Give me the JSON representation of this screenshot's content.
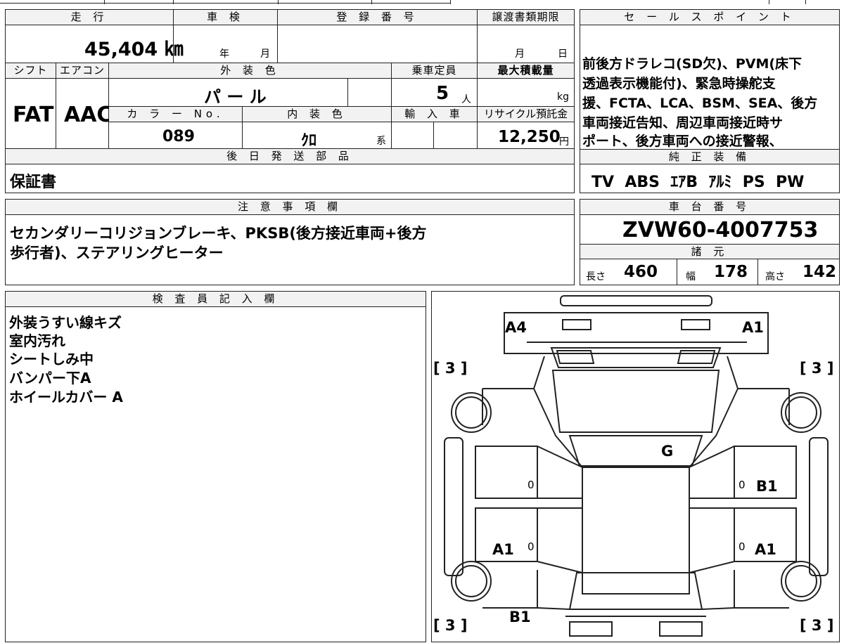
{
  "top": {
    "mileage_label": "走 行",
    "inspection_label": "車 検",
    "registration_label": "登 録 番 号",
    "transfer_label": "譲渡書類期限",
    "sales_label": "セ ー ル ス ポ イ ン ト",
    "mileage_value": "45,404 ㎞",
    "year_unit": "年",
    "month_unit": "月",
    "transfer_month": "月",
    "transfer_day": "日"
  },
  "row2": {
    "shift_label": "シフト",
    "aircon_label": "エアコン",
    "exterior_label": "外 装 色",
    "capacity_label": "乗車定員",
    "maxload_label": "最大積載量",
    "shift_value": "FAT",
    "aircon_value": "AAC",
    "exterior_value": "パ ー ル",
    "capacity_value": "5",
    "capacity_unit": "人",
    "maxload_unit": "kg",
    "color_no_label": "カ ラ ー No.",
    "interior_label": "内 装 色",
    "import_label": "輸 入 車",
    "recycle_label": "リサイクル預託金",
    "color_no_value": "089",
    "interior_value": "ｸﾛ",
    "interior_suffix": "系",
    "recycle_value": "12,250",
    "recycle_unit": "円"
  },
  "sales_points": [
    "前後方ドラレコ(SD欠)、PVM(床下",
    "透過表示機能付)、緊急時操舵支",
    "援、FCTA、LCA、BSM、SEA、後方",
    "車両接近告知、周辺車両接近時サ",
    "ポート、後方車両への接近警報、"
  ],
  "later_parts": {
    "label": "後 日 発 送 部 品",
    "value": "保証書"
  },
  "equipment": {
    "label": "純 正 装 備",
    "value": "TV  ABS  ｴｱB  ｱﾙﾐ  PS  PW"
  },
  "notes": {
    "label": "注 意 事 項 欄",
    "lines": [
      "セカンダリーコリジョンブレーキ、PKSB(後方接近車両+後方",
      "歩行者)、ステアリングヒーター"
    ]
  },
  "chassis": {
    "label": "車 台 番 号",
    "value": "ZVW60-4007753"
  },
  "specs": {
    "label": "諸 元",
    "length_label": "長さ",
    "length_value": "460",
    "width_label": "幅",
    "width_value": "178",
    "height_label": "高さ",
    "height_value": "142"
  },
  "inspector": {
    "label": "検 査 員 記 入 欄",
    "lines": [
      "外装うすい線キズ",
      "室内汚れ",
      "シートしみ中",
      "バンパー下A",
      "ホイールカバー A"
    ]
  },
  "diagram": {
    "marks": {
      "a4": "A4",
      "a1_front_right": "A1",
      "g": "G",
      "b1_right": "B1",
      "a1_left_rear_door": "A1",
      "a1_right_rear_door": "A1",
      "b1_rear_left": "B1",
      "bracket_tl": "[ 3 ]",
      "bracket_tr": "[ 3 ]",
      "bracket_bl": "[ 3 ]",
      "bracket_br": "[ 3 ]",
      "zero": "0"
    }
  }
}
